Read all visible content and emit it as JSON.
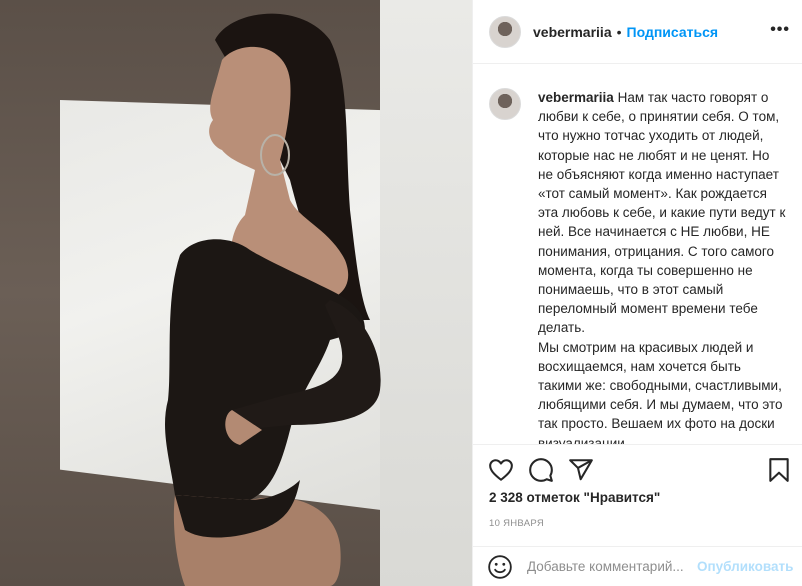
{
  "header": {
    "username": "vebermariia",
    "separator": "•",
    "follow_label": "Подписаться",
    "more_label": "•••"
  },
  "caption": {
    "username": "vebermariia",
    "paragraph1": "Нам так часто говорят о любви к себе, о принятии себя. О том, что нужно тотчас уходить от людей, которые нас не любят и не ценят. Но не объясняют когда именно наступает «тот самый момент». Как рождается эта любовь к себе, и какие пути ведут к ней. Все начинается с НЕ любви, НЕ понимания, отрицания. С того самого момента, когда ты совершенно не понимаешь, что в этот самый переломный момент времени тебе делать.",
    "paragraph2": "Мы смотрим на красивых людей и восхищаемся, нам хочется быть такими же: свободными, счастливыми, любящими себя. И мы думаем, что это так просто. Вешаем их фото на доски визуализации"
  },
  "actions": {
    "icons": [
      "heart-icon",
      "comment-icon",
      "share-icon",
      "bookmark-icon"
    ]
  },
  "likes_text": "2 328 отметок \"Нравится\"",
  "date_text": "10 января",
  "comment": {
    "placeholder": "Добавьте комментарий...",
    "publish_label": "Опубликовать"
  },
  "colors": {
    "accent": "#0095f6",
    "publish_disabled": "#b2dffc",
    "secondary_text": "#8e8e8e",
    "divider": "#efefef"
  }
}
